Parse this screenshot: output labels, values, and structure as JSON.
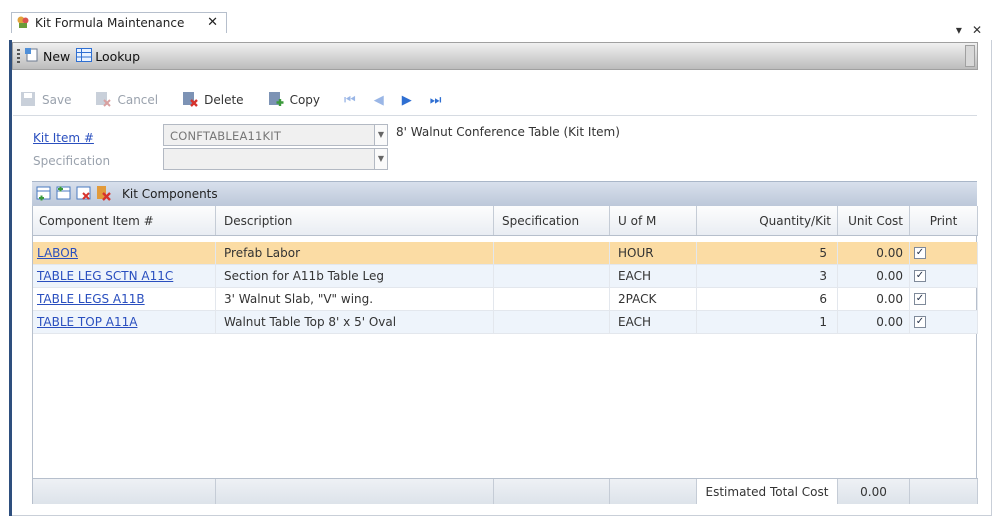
{
  "tab": {
    "title": "Kit Formula Maintenance",
    "close": "✕"
  },
  "tabbar_right": {
    "pin": "▾",
    "close": "✕"
  },
  "toolbar1": {
    "new_label": "New",
    "lookup_label": "Lookup"
  },
  "toolbar2": {
    "save_label": "Save",
    "cancel_label": "Cancel",
    "delete_label": "Delete",
    "copy_label": "Copy",
    "first": "⏮",
    "prev": "◀",
    "next": "▶",
    "last": "⏭"
  },
  "form": {
    "kit_item_label": "Kit Item #",
    "kit_item_value": "CONFTABLEA11KIT",
    "kit_item_description": "8' Walnut Conference Table (Kit Item)",
    "specification_label": "Specification",
    "specification_value": ""
  },
  "components": {
    "title": "Kit Components",
    "columns": [
      "Component Item #",
      "Description",
      "Specification",
      "U of M",
      "Quantity/Kit",
      "Unit Cost",
      "Print"
    ],
    "rows": [
      {
        "item": "LABOR",
        "description": "Prefab Labor",
        "specification": "",
        "uom": "HOUR",
        "qty": "5",
        "unit_cost": "0.00",
        "print": "✓"
      },
      {
        "item": "TABLE LEG SCTN A11C",
        "description": "Section for A11b Table Leg",
        "specification": "",
        "uom": "EACH",
        "qty": "3",
        "unit_cost": "0.00",
        "print": "✓"
      },
      {
        "item": "TABLE LEGS A11B",
        "description": "3' Walnut Slab, \"V\" wing.",
        "specification": "",
        "uom": "2PACK",
        "qty": "6",
        "unit_cost": "0.00",
        "print": "✓"
      },
      {
        "item": "TABLE TOP A11A",
        "description": "Walnut Table Top 8' x 5' Oval",
        "specification": "",
        "uom": "EACH",
        "qty": "1",
        "unit_cost": "0.00",
        "print": "✓"
      }
    ],
    "footer": {
      "estimated_label": "Estimated Total Cost",
      "estimated_value": "0.00"
    }
  },
  "colors": {
    "selected_row": "#fbdca4",
    "alt_row": "#eef4fb",
    "link": "#2a4fbf",
    "strip": "#c7d2e1"
  }
}
